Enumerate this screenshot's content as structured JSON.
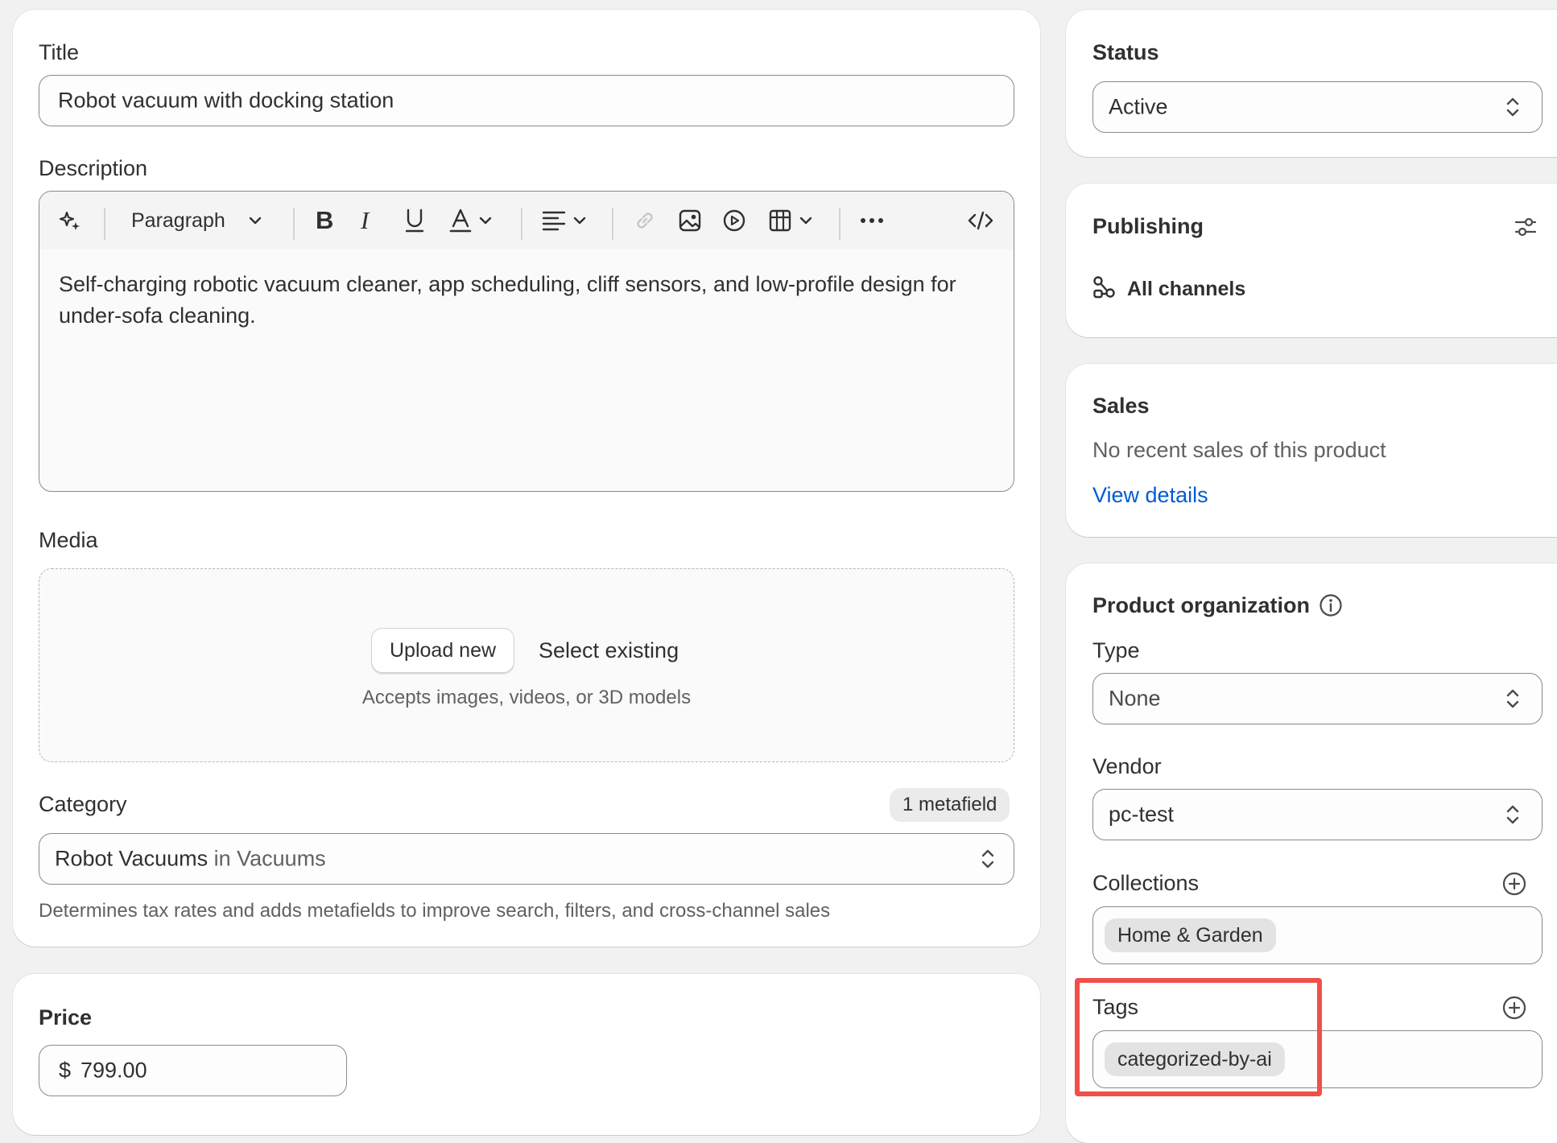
{
  "main": {
    "title_label": "Title",
    "title_value": "Robot vacuum with docking station",
    "description_label": "Description",
    "toolbar": {
      "paragraph_label": "Paragraph"
    },
    "description_text": "Self-charging robotic vacuum cleaner, app scheduling, cliff sensors, and low-profile design for under-sofa cleaning.",
    "media_label": "Media",
    "upload_button": "Upload new",
    "select_existing": "Select existing",
    "media_hint": "Accepts images, videos, or 3D models",
    "category_label": "Category",
    "metafield_badge": "1 metafield",
    "category_value": "Robot Vacuums",
    "category_parent": "in Vacuums",
    "category_hint": "Determines tax rates and adds metafields to improve search, filters, and cross-channel sales",
    "price_label": "Price",
    "price_currency": "$",
    "price_value": "799.00"
  },
  "sidebar": {
    "status_label": "Status",
    "status_value": "Active",
    "publishing_label": "Publishing",
    "publishing_channels": "All channels",
    "sales_label": "Sales",
    "sales_text": "No recent sales of this product",
    "sales_link": "View details",
    "org_label": "Product organization",
    "type_label": "Type",
    "type_value": "None",
    "vendor_label": "Vendor",
    "vendor_value": "pc-test",
    "collections_label": "Collections",
    "collections": [
      "Home & Garden"
    ],
    "tags_label": "Tags",
    "tags": [
      "categorized-by-ai"
    ]
  },
  "colors": {
    "link": "#005bd3",
    "highlight": "#f0504a",
    "background": "#f1f1f1"
  }
}
